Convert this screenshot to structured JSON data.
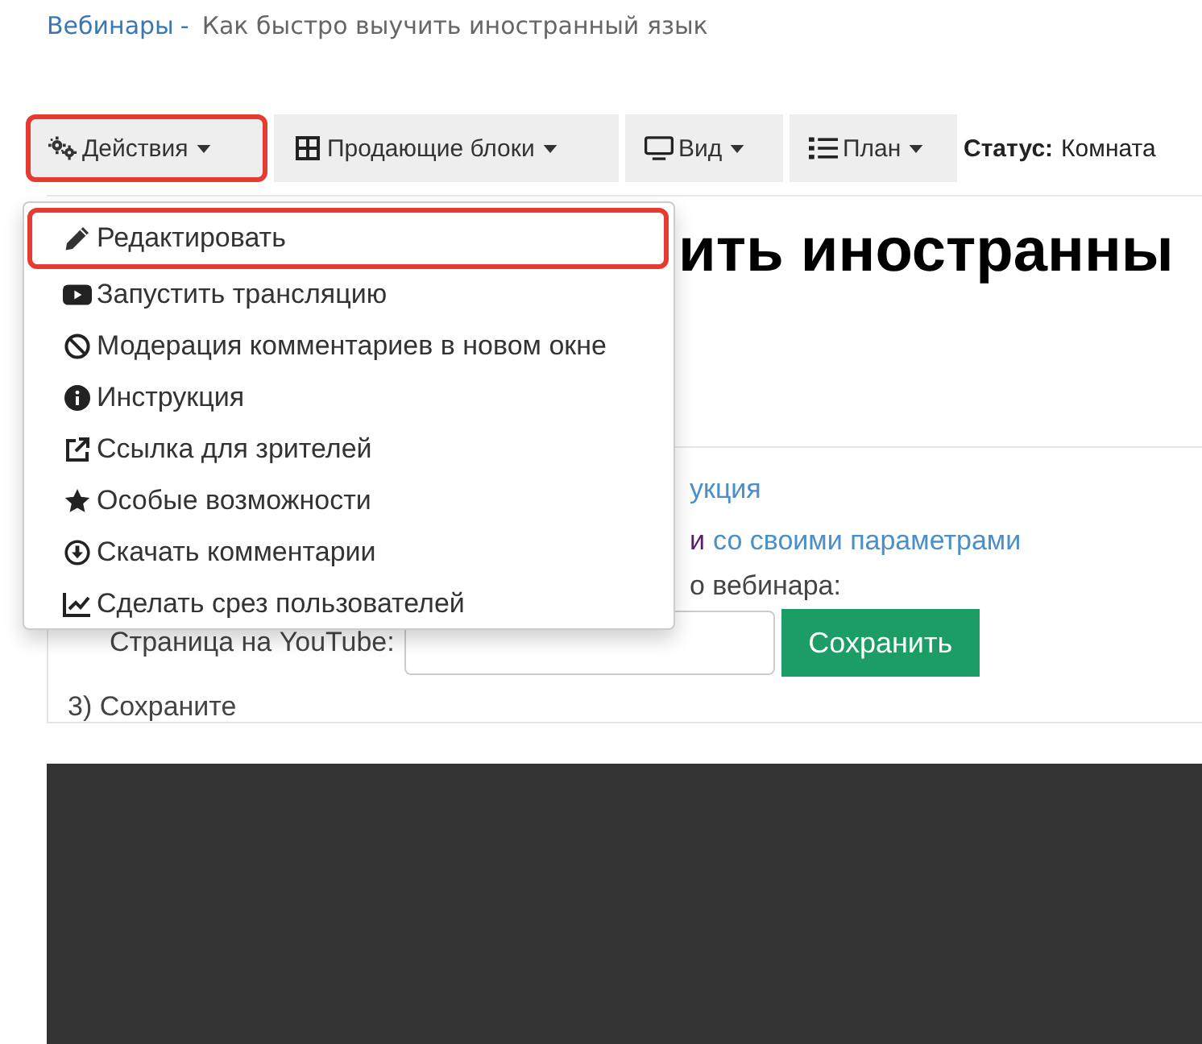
{
  "breadcrumb": {
    "link": "Вебинары",
    "separator": "-",
    "current": "Как быстро выучить иностранный язык"
  },
  "toolbar": {
    "buttons": [
      {
        "label": "Действия",
        "highlighted": true
      },
      {
        "label": "Продающие блоки",
        "highlighted": false
      },
      {
        "label": "Вид",
        "highlighted": false
      },
      {
        "label": "План",
        "highlighted": false
      }
    ],
    "status_label": "Статус:",
    "status_value": "Комната"
  },
  "dropdown": {
    "items": [
      {
        "label": "Редактировать",
        "highlighted": true
      },
      {
        "label": "Запустить трансляцию",
        "highlighted": false
      },
      {
        "label": "Модерация комментариев в новом окне",
        "highlighted": false
      },
      {
        "label": "Инструкция",
        "highlighted": false
      },
      {
        "label": "Ссылка для зрителей",
        "highlighted": false
      },
      {
        "label": "Особые возможности",
        "highlighted": false
      },
      {
        "label": "Скачать комментарии",
        "highlighted": false
      },
      {
        "label": "Сделать срез пользователей",
        "highlighted": false
      }
    ]
  },
  "content": {
    "heading": "ить иностранны",
    "instruction_link": "укция",
    "params_prefix": "и",
    "params_link": "со своими параметрами",
    "webinar_text": "о вебинара:",
    "youtube_label": "Страница на YouTube:",
    "save_button": "Сохранить",
    "step3": "3) Сохраните"
  }
}
